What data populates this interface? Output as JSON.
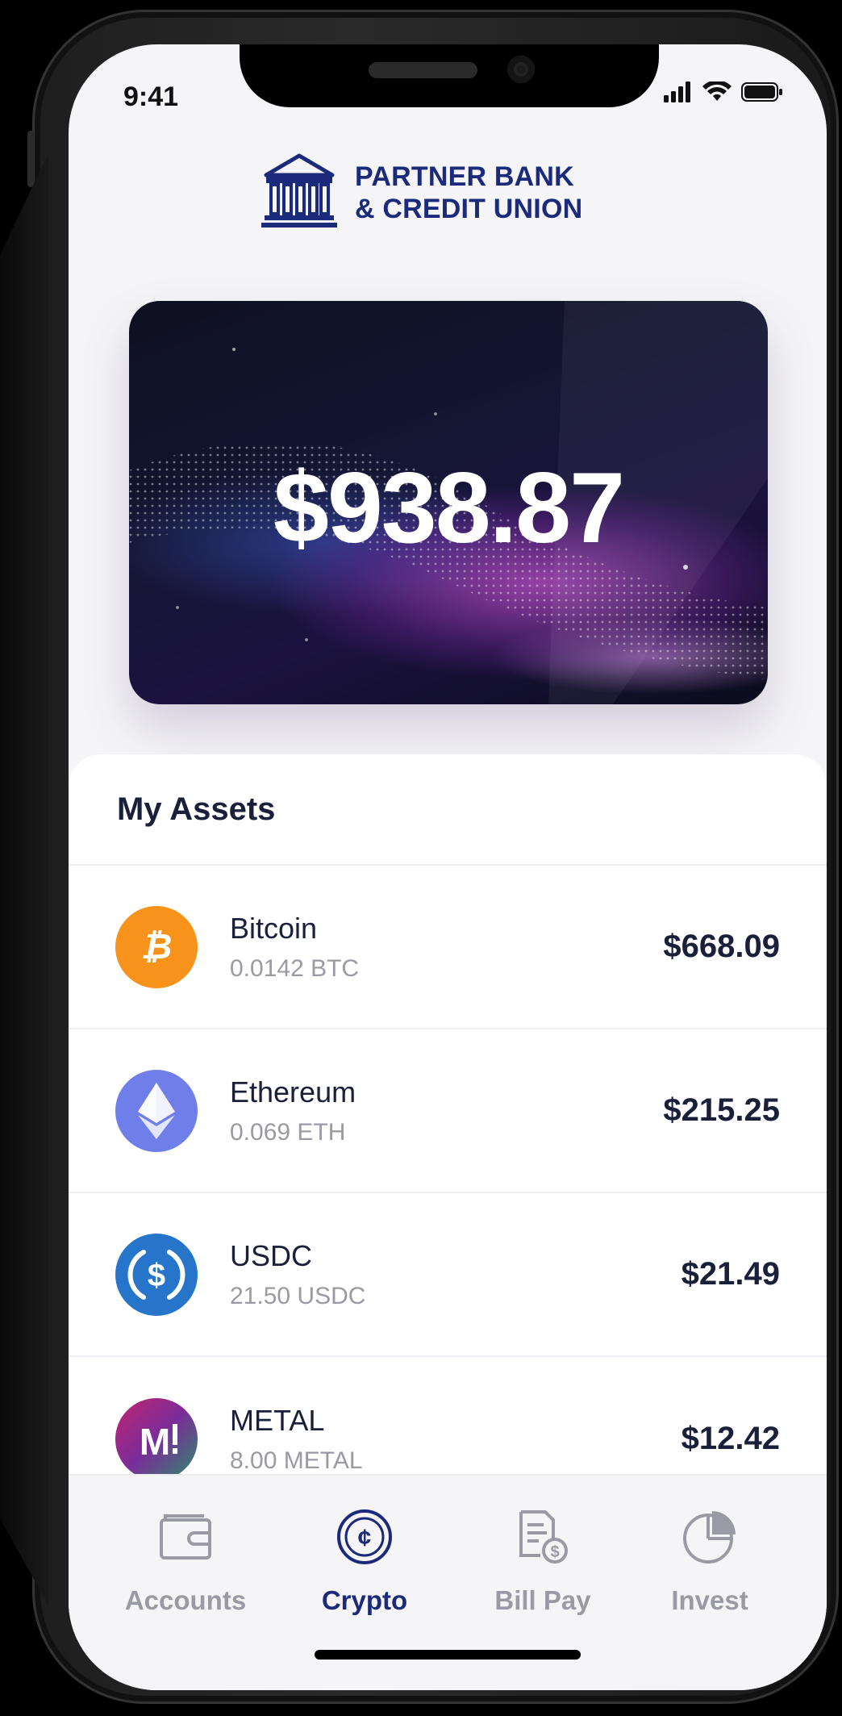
{
  "status_bar": {
    "time": "9:41",
    "signal_icon": "signal-bars-icon",
    "wifi_icon": "wifi-icon",
    "battery_icon": "battery-icon"
  },
  "brand": {
    "logo_icon": "bank-building-icon",
    "name_line1": "PARTNER BANK",
    "name_line2": "& CREDIT UNION",
    "color": "#1b2a7a"
  },
  "balance_card": {
    "amount": "$938.87"
  },
  "assets": {
    "title": "My Assets",
    "items": [
      {
        "name": "Bitcoin",
        "amount": "0.0142 BTC",
        "value": "$668.09",
        "icon": "bitcoin-icon",
        "color": "#f7931a"
      },
      {
        "name": "Ethereum",
        "amount": "0.069 ETH",
        "value": "$215.25",
        "icon": "ethereum-icon",
        "color": "#6f7ee8"
      },
      {
        "name": "USDC",
        "amount": "21.50 USDC",
        "value": "$21.49",
        "icon": "usdc-icon",
        "color": "#2775ca"
      },
      {
        "name": "METAL",
        "amount": "8.00 METAL",
        "value": "$12.42",
        "icon": "metal-icon",
        "color": "#8a2c8f"
      }
    ]
  },
  "tabbar": {
    "tabs": [
      {
        "label": "Accounts",
        "icon": "wallet-icon",
        "active": false
      },
      {
        "label": "Crypto",
        "icon": "crypto-coin-icon",
        "active": true
      },
      {
        "label": "Bill Pay",
        "icon": "bill-icon",
        "active": false
      },
      {
        "label": "Invest",
        "icon": "pie-chart-icon",
        "active": false
      }
    ],
    "active_color": "#1b2a7a",
    "inactive_color": "#9a9aa4"
  }
}
